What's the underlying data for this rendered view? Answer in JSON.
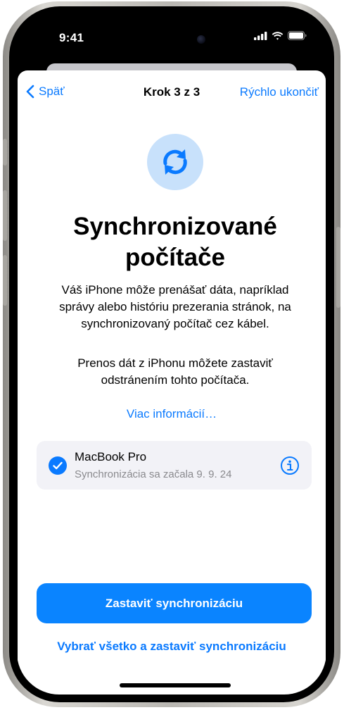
{
  "status_bar": {
    "time": "9:41",
    "icons": [
      "cellular-signal-icon",
      "wifi-icon",
      "battery-icon"
    ]
  },
  "nav": {
    "back_label": "Späť",
    "title": "Krok 3 z 3",
    "quick_exit_label": "Rýchlo ukončiť"
  },
  "hero": {
    "icon": "sync-arrows-icon",
    "title": "Synchronizované\npočítače"
  },
  "body": {
    "paragraph_1": "Váš iPhone môže prenášať dáta, napríklad správy alebo históriu prezerania stránok, na synchronizovaný počítač cez kábel.",
    "paragraph_2": "Prenos dát z iPhonu môžete zastaviť odstránením tohto počítača.",
    "more_info_link": "Viac informácií…"
  },
  "computers": [
    {
      "name": "MacBook Pro",
      "detail": "Synchronizácia sa začala 9. 9. 24",
      "selected": true
    }
  ],
  "actions": {
    "primary_label": "Zastaviť synchronizáciu",
    "secondary_label": "Vybrať všetko a zastaviť synchronizáciu"
  },
  "colors": {
    "accent": "#0a7aff",
    "button": "#0a84ff",
    "hero_bg": "#c8e1fb",
    "card_bg": "#f2f2f7",
    "secondary_text": "#8a8a8e"
  }
}
